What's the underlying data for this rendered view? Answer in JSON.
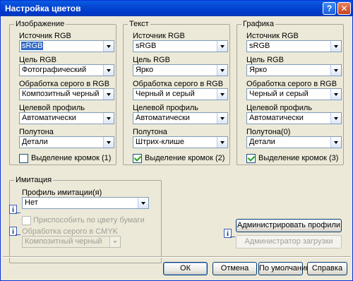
{
  "window": {
    "title": "Настройка цветов",
    "help_label": "?",
    "close_label": "✕"
  },
  "groups": {
    "image": {
      "legend": "Изображение",
      "source_label": "Источник RGB",
      "source_value": "sRGB",
      "target_label": "Цель RGB",
      "target_value": "Фотографический",
      "gray_label": "Обработка серого в RGB",
      "gray_value": "Композитный черный",
      "profile_label": "Целевой профиль",
      "profile_value": "Автоматически",
      "halftone_label": "Полутона",
      "halftone_value": "Детали",
      "edge_label": "Выделение кромок (1)",
      "edge_checked": false
    },
    "text": {
      "legend": "Текст",
      "source_label": "Источник RGB",
      "source_value": "sRGB",
      "target_label": "Цель RGB",
      "target_value": "Ярко",
      "gray_label": "Обработка серого в RGB",
      "gray_value": "Черный и серый",
      "profile_label": "Целевой профиль",
      "profile_value": "Автоматически",
      "halftone_label": "Полутона",
      "halftone_value": "Штрих-клише",
      "edge_label": "Выделение кромок (2)",
      "edge_checked": true
    },
    "graphics": {
      "legend": "Графика",
      "source_label": "Источник RGB",
      "source_value": "sRGB",
      "target_label": "Цель RGB",
      "target_value": "Ярко",
      "gray_label": "Обработка серого в RGB",
      "gray_value": "Черный и серый",
      "profile_label": "Целевой профиль",
      "profile_value": "Автоматически",
      "halftone_label": "Полутона(0)",
      "halftone_value": "Детали",
      "edge_label": "Выделение кромок (3)",
      "edge_checked": true
    },
    "simulation": {
      "legend": "Имитация",
      "profile_label": "Профиль имитации(я)",
      "profile_value": "Нет",
      "paper_label": "Приспособить по цвету бумаги",
      "cmyk_label": "Обработка серого в CMYK",
      "cmyk_value": "Композитный черный"
    }
  },
  "buttons": {
    "manage_profiles": "Администрировать профили",
    "load_admin": "Администратор загрузки",
    "ok": "ОК",
    "cancel": "Отмена",
    "defaults": "По умолчанию",
    "help": "Справка"
  },
  "info_glyph": "i",
  "colors": {
    "title_bar": "#0547d3",
    "selection": "#316ac5",
    "dialog_bg": "#ece9d8"
  }
}
